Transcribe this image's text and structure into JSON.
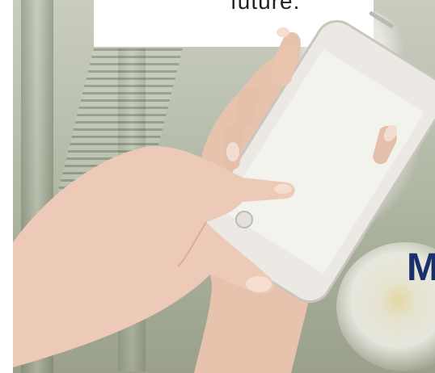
{
  "hero": {
    "top_text": "future.",
    "right_text": "M"
  },
  "colors": {
    "heading_navy": "#1b2f6b",
    "panel_white": "#ffffff",
    "skin": "#ecc8b4",
    "phone_frame": "#e9e6e1"
  },
  "icons": {
    "phone": "smartphone-icon",
    "home_button": "home-button-icon"
  }
}
